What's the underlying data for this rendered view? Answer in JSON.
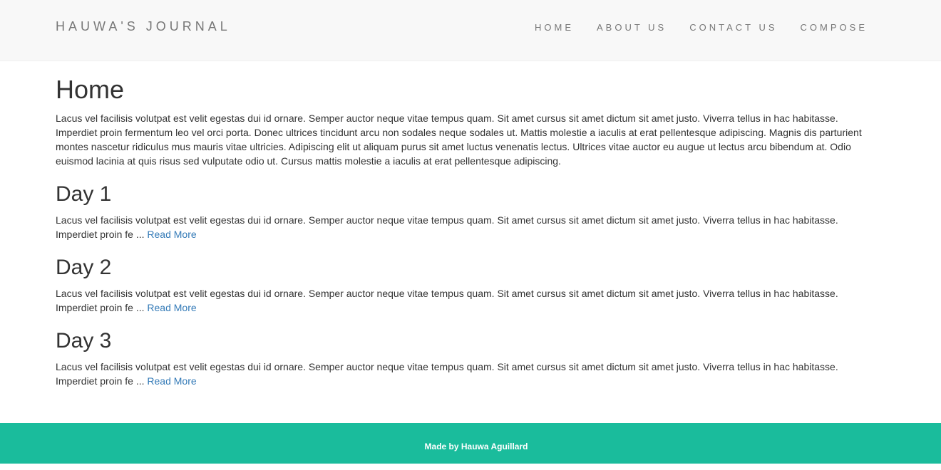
{
  "header": {
    "brand": "HAUWA'S JOURNAL",
    "nav": [
      {
        "label": "HOME"
      },
      {
        "label": "ABOUT US"
      },
      {
        "label": "CONTACT US"
      },
      {
        "label": "COMPOSE"
      }
    ]
  },
  "home": {
    "title": "Home",
    "intro": "Lacus vel facilisis volutpat est velit egestas dui id ornare. Semper auctor neque vitae tempus quam. Sit amet cursus sit amet dictum sit amet justo. Viverra tellus in hac habitasse. Imperdiet proin fermentum leo vel orci porta. Donec ultrices tincidunt arcu non sodales neque sodales ut. Mattis molestie a iaculis at erat pellentesque adipiscing. Magnis dis parturient montes nascetur ridiculus mus mauris vitae ultricies. Adipiscing elit ut aliquam purus sit amet luctus venenatis lectus. Ultrices vitae auctor eu augue ut lectus arcu bibendum at. Odio euismod lacinia at quis risus sed vulputate odio ut. Cursus mattis molestie a iaculis at erat pellentesque adipiscing."
  },
  "posts": [
    {
      "title": "Day 1",
      "excerpt": "Lacus vel facilisis volutpat est velit egestas dui id ornare. Semper auctor neque vitae tempus quam. Sit amet cursus sit amet dictum sit amet justo. Viverra tellus in hac habitasse. Imperdiet proin fe ...",
      "read_more": "Read More"
    },
    {
      "title": "Day 2",
      "excerpt": "Lacus vel facilisis volutpat est velit egestas dui id ornare. Semper auctor neque vitae tempus quam. Sit amet cursus sit amet dictum sit amet justo. Viverra tellus in hac habitasse. Imperdiet proin fe ...",
      "read_more": "Read More"
    },
    {
      "title": "Day 3",
      "excerpt": "Lacus vel facilisis volutpat est velit egestas dui id ornare. Semper auctor neque vitae tempus quam. Sit amet cursus sit amet dictum sit amet justo. Viverra tellus in hac habitasse. Imperdiet proin fe ...",
      "read_more": "Read More"
    }
  ],
  "footer": {
    "text": "Made by Hauwa Aguillard"
  },
  "colors": {
    "navbar_bg": "#f8f8f8",
    "footer_bg": "#1abc9c",
    "link": "#337ab7"
  }
}
